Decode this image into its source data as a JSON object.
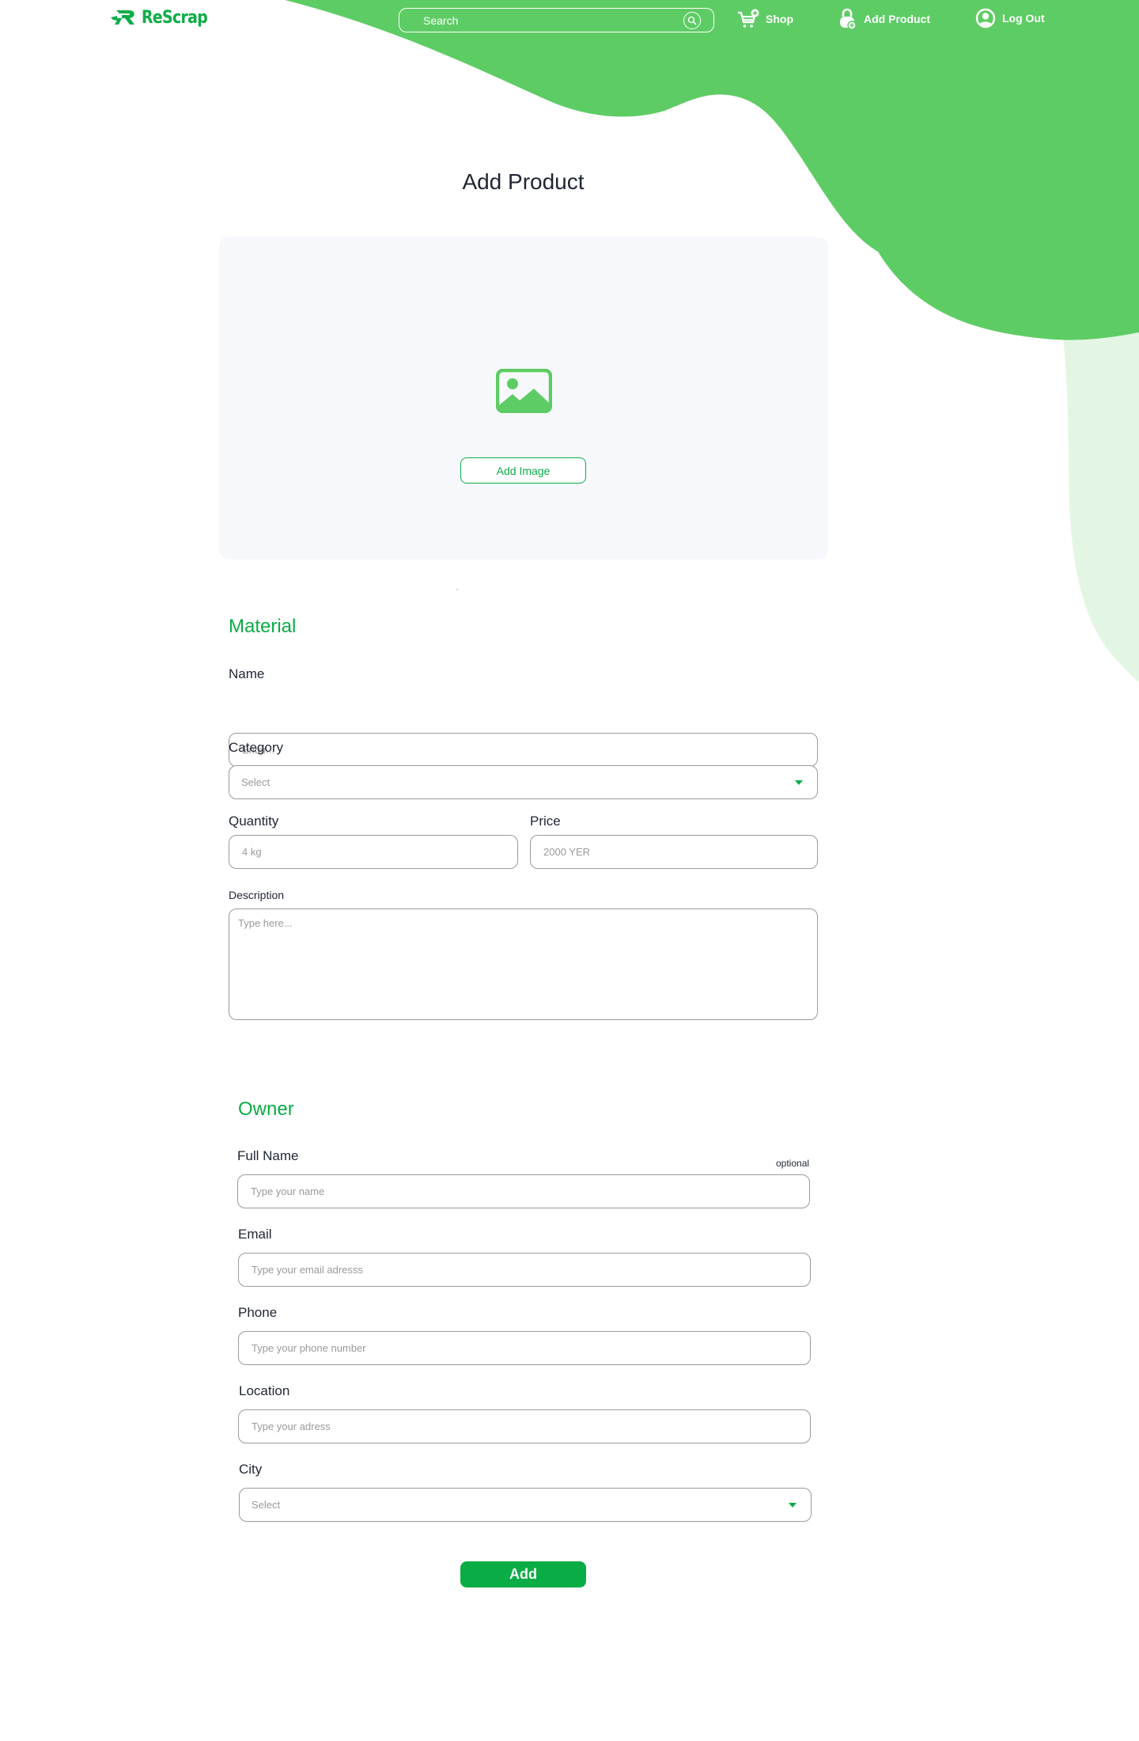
{
  "brand": {
    "name": "ReScrap",
    "accent_color": "#0aad45",
    "header_green": "#5ecc64",
    "light_green": "#e3f6e4"
  },
  "header": {
    "search": {
      "placeholder": "Search",
      "icon": "search-icon"
    },
    "nav": [
      {
        "label": "Shop",
        "icon": "cart-plus-icon"
      },
      {
        "label": "Add Product",
        "icon": "bag-plus-icon"
      },
      {
        "label": "Log Out",
        "icon": "user-circle-icon"
      }
    ]
  },
  "page": {
    "title": "Add Product"
  },
  "upload": {
    "icon": "image-icon",
    "button_label": "Add Image"
  },
  "material": {
    "heading": "Material",
    "name": {
      "label": "Name",
      "placeholder": "Enter..."
    },
    "category": {
      "label": "Category",
      "value": "Select"
    },
    "quantity": {
      "label": "Quantity",
      "placeholder": "4 kg"
    },
    "price": {
      "label": "Price",
      "placeholder": "2000 YER"
    },
    "description": {
      "label": "Description",
      "placeholder": "Type here..."
    }
  },
  "owner": {
    "heading": "Owner",
    "optional_hint": "optional",
    "full_name": {
      "label": "Full Name",
      "placeholder": "Type your name"
    },
    "email": {
      "label": "Email",
      "placeholder": "Type your email adresss"
    },
    "phone": {
      "label": "Phone",
      "placeholder": "Type your phone number"
    },
    "location": {
      "label": "Location",
      "placeholder": "Type your adress"
    },
    "city": {
      "label": "City",
      "value": "Select"
    }
  },
  "actions": {
    "submit_label": "Add"
  }
}
